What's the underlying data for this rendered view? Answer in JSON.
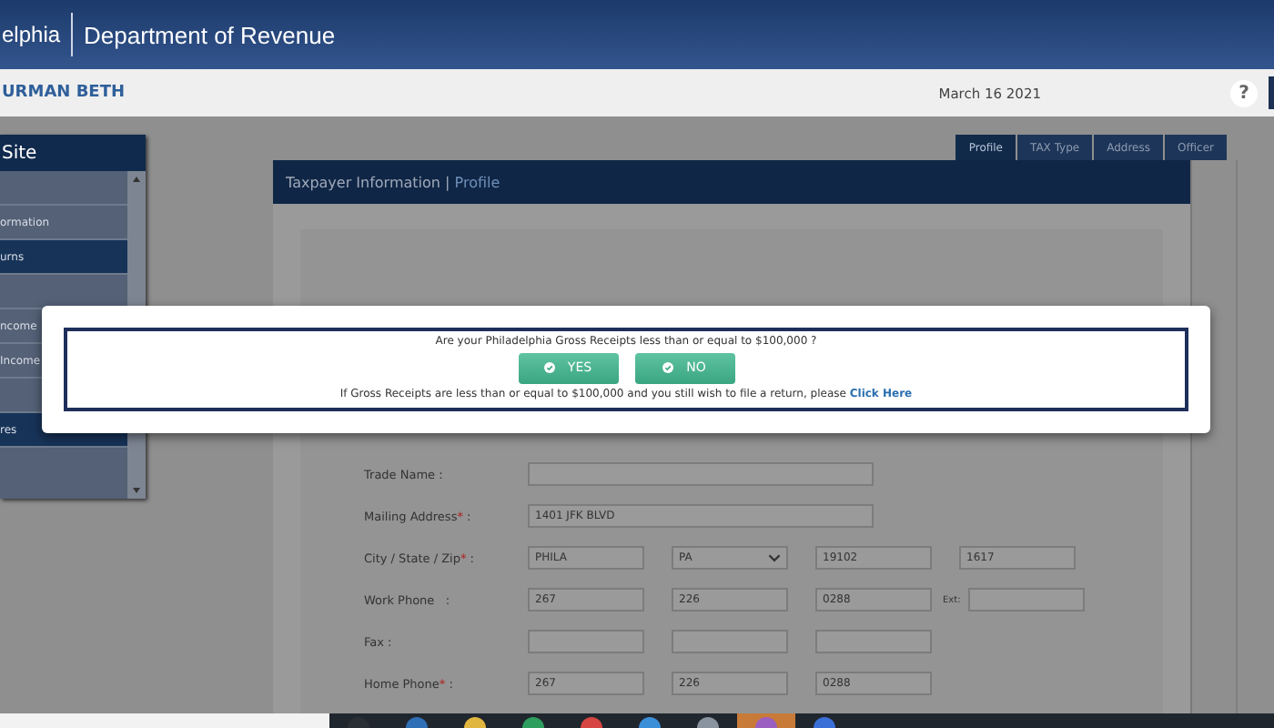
{
  "header": {
    "city": "elphia",
    "department": "Department of Revenue"
  },
  "user_bar": {
    "user": "URMAN BETH",
    "date": "March 16 2021",
    "help": "?"
  },
  "sidebar": {
    "title": "Site",
    "items": [
      {
        "selected": false
      },
      {
        "label": "ormation",
        "selected": false
      },
      {
        "label": "urns",
        "selected": true
      },
      {
        "selected": false
      },
      {
        "label": "ncome",
        "selected": false
      },
      {
        "label": "Income",
        "selected": false
      },
      {
        "selected": false
      },
      {
        "label": "res",
        "selected": true
      }
    ]
  },
  "tabs": [
    {
      "label": "Profile",
      "selected": true
    },
    {
      "label": "TAX Type",
      "selected": false
    },
    {
      "label": "Address",
      "selected": false
    },
    {
      "label": "Officer",
      "selected": false
    }
  ],
  "panel": {
    "title": "Taxpayer Information",
    "separator": "|",
    "subtitle": "Profile"
  },
  "form_rows": [
    {
      "label": "Trade Name :",
      "fields": [
        {
          "kind": "wide"
        }
      ]
    },
    {
      "label": "Mailing Address",
      "required_mark": "*",
      "suffix": " :",
      "fields": [
        {
          "kind": "wide",
          "value": "1401 JFK BLVD"
        }
      ]
    },
    {
      "label": "City / State / Zip",
      "required_mark": "*",
      "suffix": " :",
      "fields": [
        {
          "kind": "text",
          "value": "PHILA"
        },
        {
          "kind": "select",
          "value": "PA"
        },
        {
          "kind": "text",
          "value": "19102"
        },
        {
          "kind": "text",
          "value": "1617"
        }
      ]
    },
    {
      "label": "Work Phone   :",
      "fields": [
        {
          "kind": "text",
          "value": "267"
        },
        {
          "kind": "text",
          "value": "226"
        },
        {
          "kind": "text",
          "value": "0288"
        },
        {
          "kind": "ext",
          "prefix": "Ext:"
        }
      ]
    },
    {
      "label": "Fax :",
      "fields": [
        {
          "kind": "text"
        },
        {
          "kind": "text"
        },
        {
          "kind": "text"
        }
      ]
    },
    {
      "label": "Home Phone",
      "required_mark": "*",
      "suffix": " :",
      "fields": [
        {
          "kind": "text",
          "value": "267"
        },
        {
          "kind": "text",
          "value": "226"
        },
        {
          "kind": "text",
          "value": "0288"
        }
      ]
    }
  ],
  "modal": {
    "question": "Are your Philadelphia Gross Receipts less than or equal to $100,000 ?",
    "buttons": [
      {
        "label": "YES"
      },
      {
        "label": "NO"
      }
    ],
    "note": "If Gross Receipts are less than or equal to $100,000 and you still wish to file a return, please",
    "link": "Click Here"
  }
}
